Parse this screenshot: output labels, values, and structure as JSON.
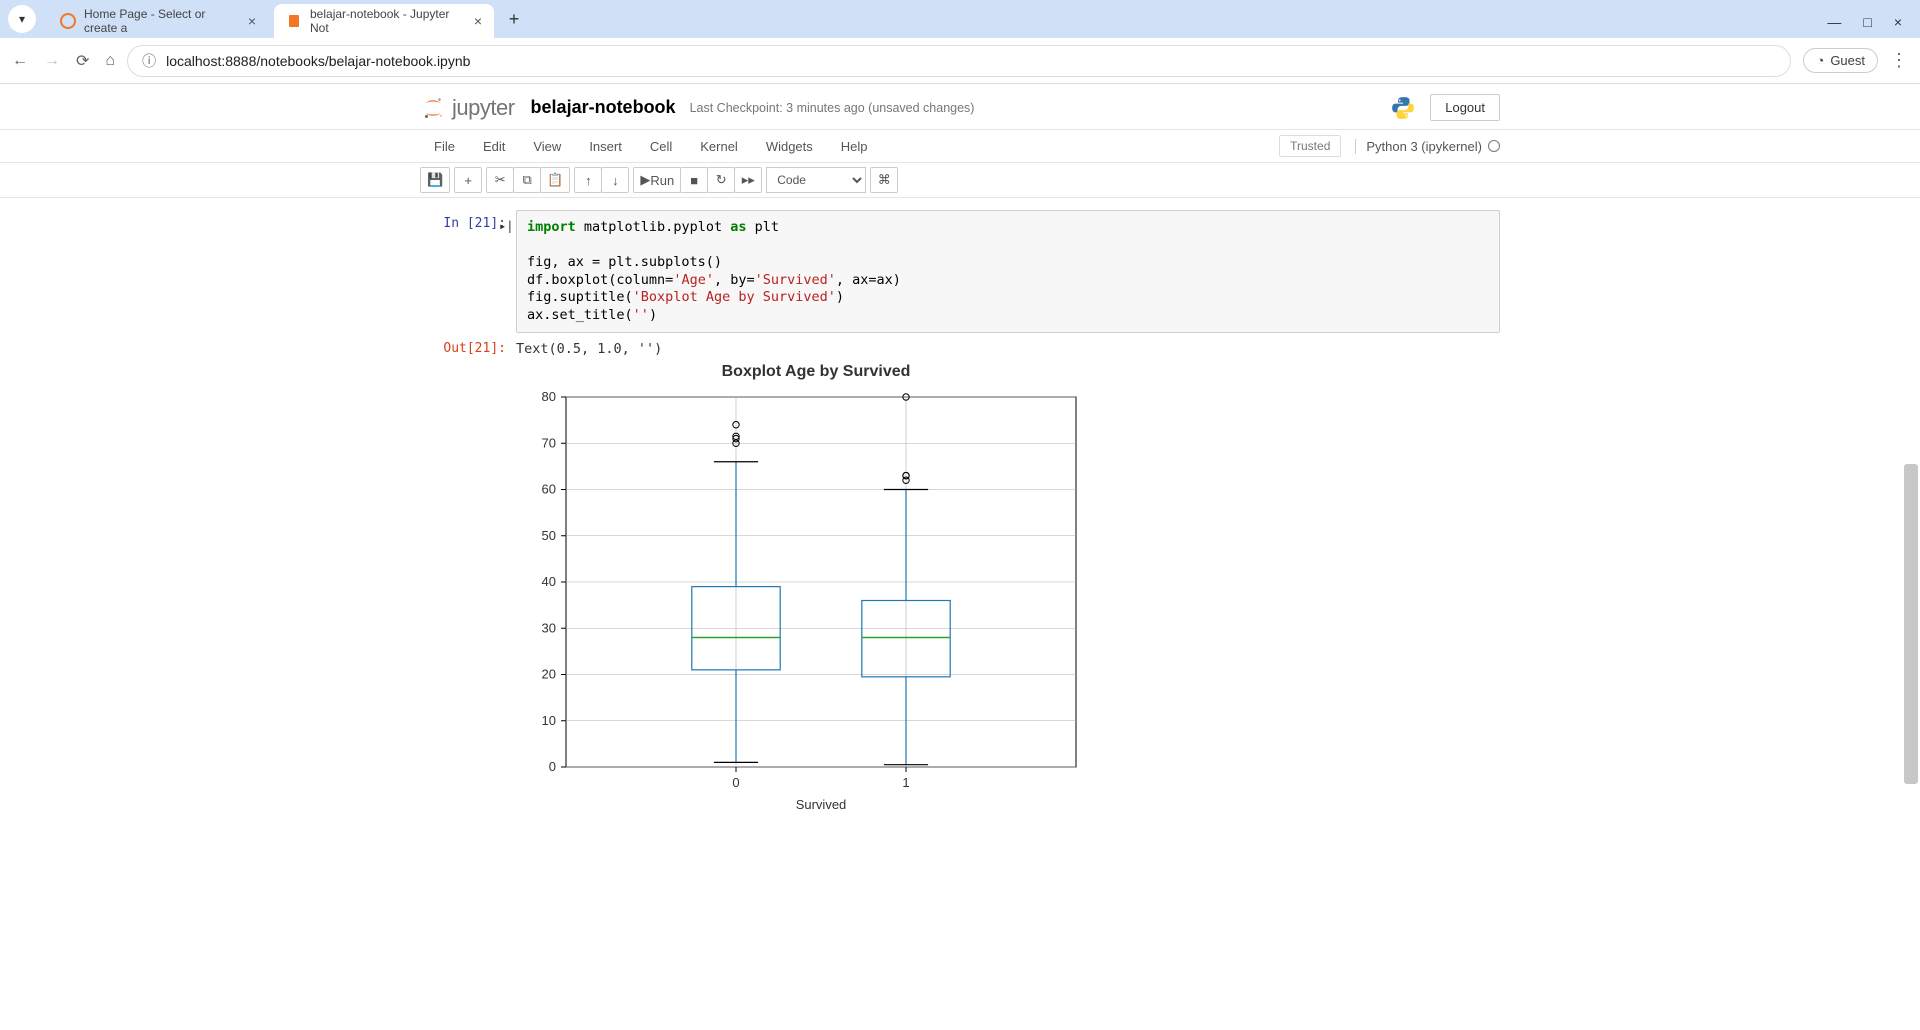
{
  "browser": {
    "tab1": "Home Page - Select or create a",
    "tab2": "belajar-notebook - Jupyter Not",
    "url": "localhost:8888/notebooks/belajar-notebook.ipynb",
    "guest": "Guest"
  },
  "header": {
    "logo_text": "jupyter",
    "notebook_name": "belajar-notebook",
    "checkpoint": "Last Checkpoint: 3 minutes ago  (unsaved changes)",
    "logout": "Logout"
  },
  "menubar": {
    "items": [
      "File",
      "Edit",
      "View",
      "Insert",
      "Cell",
      "Kernel",
      "Widgets",
      "Help"
    ],
    "trusted": "Trusted",
    "kernel": "Python 3 (ipykernel)"
  },
  "toolbar": {
    "run": "Run",
    "celltype": "Code"
  },
  "cell": {
    "in_prompt": "In [21]:",
    "out_prompt": "Out[21]:",
    "code_lines": {
      "l1a": "import",
      "l1b": " matplotlib.pyplot ",
      "l1c": "as",
      "l1d": " plt",
      "l2": "",
      "l3": "fig, ax = plt.subplots()",
      "l4a": "df.boxplot(column=",
      "l4b": "'Age'",
      "l4c": ", by=",
      "l4d": "'Survived'",
      "l4e": ", ax=ax)",
      "l5a": "fig.suptitle(",
      "l5b": "'Boxplot Age by Survived'",
      "l5c": ")",
      "l6a": "ax.set_title(",
      "l6b": "''",
      "l6c": ")"
    },
    "output_text": "Text(0.5, 1.0, '')"
  },
  "chart_data": {
    "type": "boxplot",
    "title": "Boxplot Age by Survived",
    "xlabel": "Survived",
    "ylabel": "",
    "categories": [
      "0",
      "1"
    ],
    "ylim": [
      0,
      80
    ],
    "yticks": [
      0,
      10,
      20,
      30,
      40,
      50,
      60,
      70,
      80
    ],
    "boxes": [
      {
        "category": "0",
        "whisker_low": 1,
        "q1": 21,
        "median": 28,
        "q3": 39,
        "whisker_high": 66,
        "outliers": [
          70,
          71,
          71.5,
          74
        ]
      },
      {
        "category": "1",
        "whisker_low": 0.5,
        "q1": 19.5,
        "median": 28,
        "q3": 36,
        "whisker_high": 60,
        "outliers": [
          62,
          63,
          63,
          80
        ]
      }
    ]
  }
}
